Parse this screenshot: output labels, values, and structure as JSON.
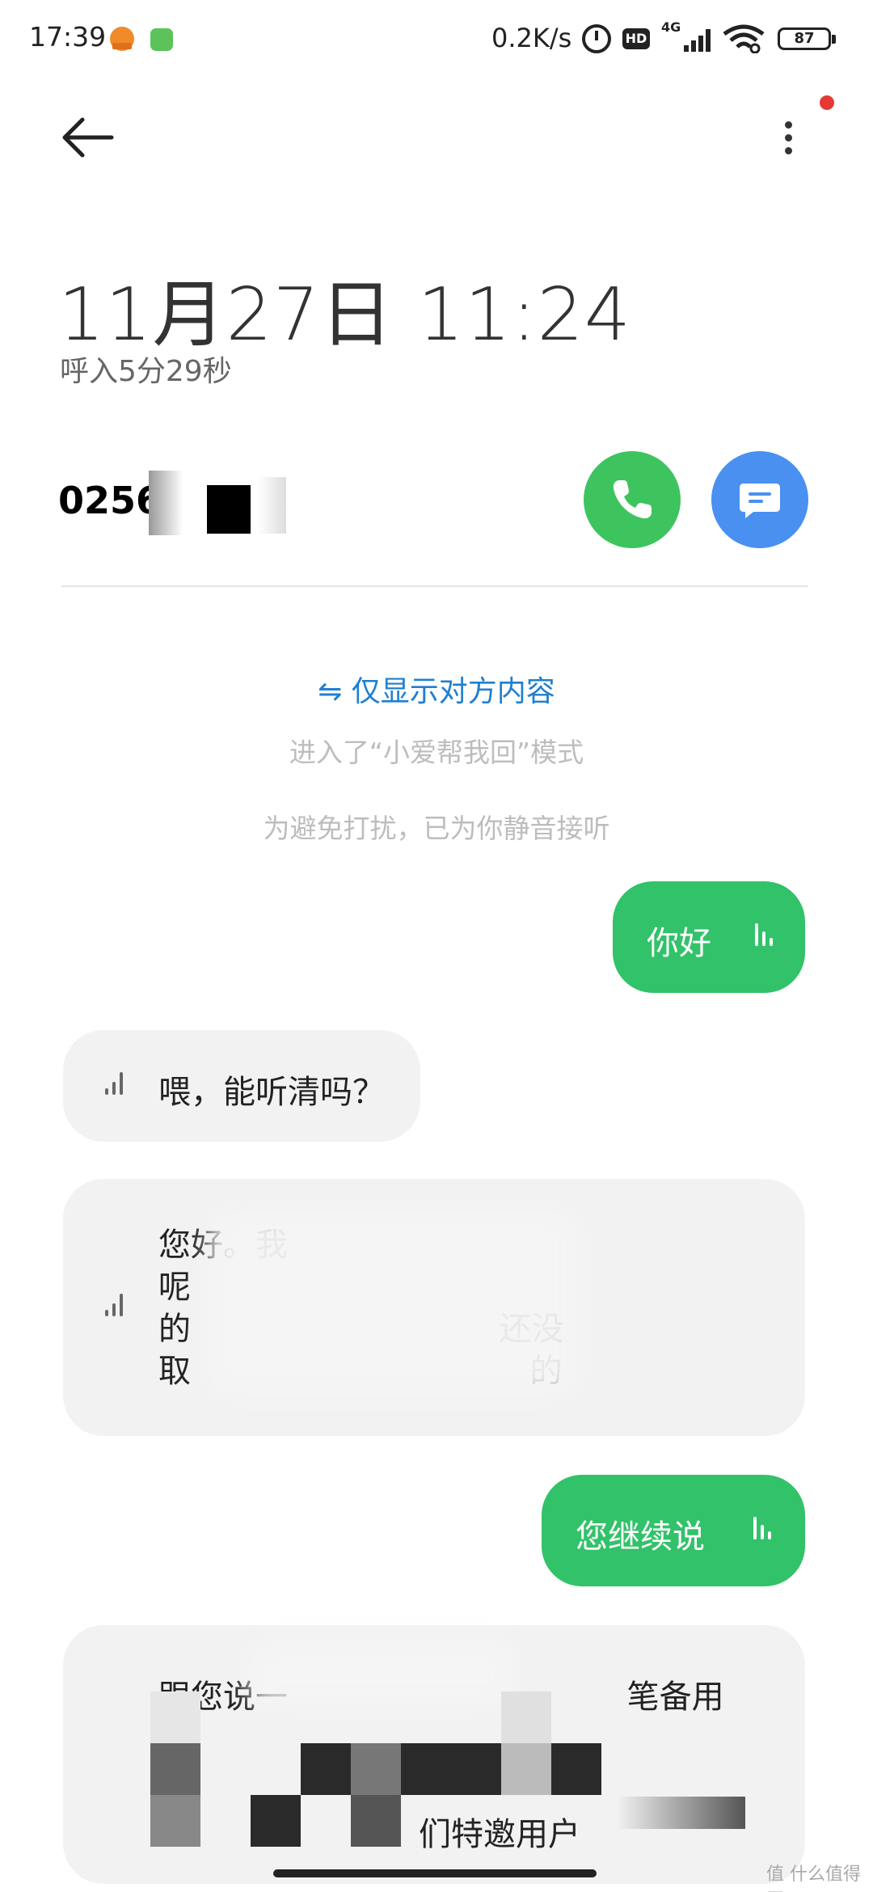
{
  "status_bar": {
    "time": "17:39",
    "speed": "0.2K/s",
    "hd": "HD",
    "network": "4G",
    "battery": "87"
  },
  "header": {
    "back_icon": "arrow-left-icon",
    "more_icon": "more-vertical-icon"
  },
  "call": {
    "date_time": "11月27日  11:24",
    "subtitle": "呼入5分29秒",
    "number": "0256          74"
  },
  "filter": {
    "label": "⇋ 仅显示对方内容"
  },
  "system_notes": [
    "进入了“小爱帮我回”模式",
    "为避免打扰，已为你静音接听"
  ],
  "messages": [
    {
      "side": "right",
      "text": "你好"
    },
    {
      "side": "left",
      "text": "喂，能听清吗？"
    },
    {
      "side": "left",
      "text": "您好。我\n呢\n的                              还没\n取                                 的"
    },
    {
      "side": "right",
      "text": "您继续说"
    },
    {
      "side": "left",
      "text": "跟您说一                                 笔备用",
      "text2": "们特邀用户"
    }
  ],
  "colors": {
    "accent_green": "#3ec45f",
    "accent_blue": "#4a90f0",
    "link_blue": "#1f7fd1",
    "bubble_right": "#32c26a",
    "bubble_left": "#f2f2f2"
  },
  "watermark": "值 什么值得买"
}
